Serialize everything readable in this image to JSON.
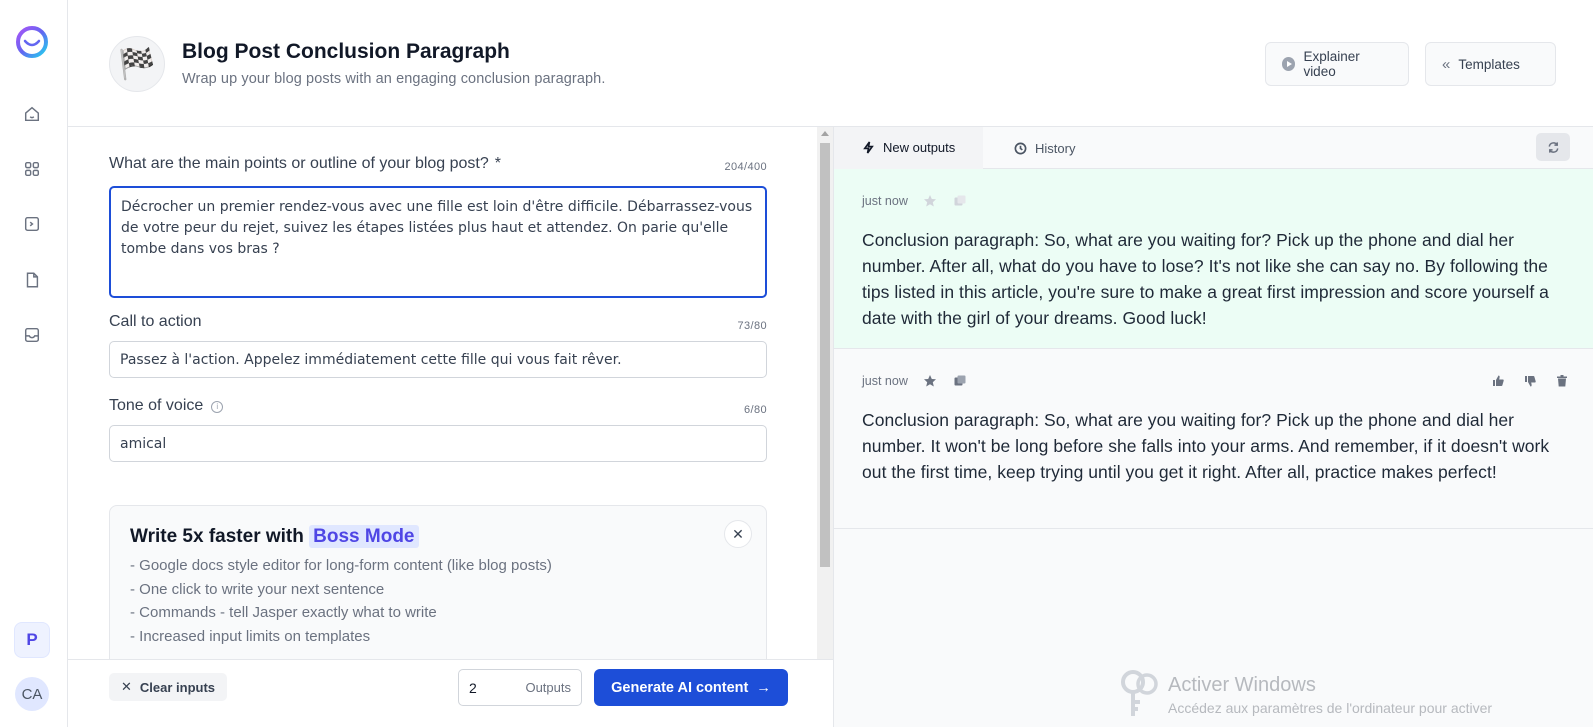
{
  "sidebar": {
    "workspace_initial": "P",
    "user_initials": "CA",
    "items": [
      {
        "icon": "home-icon"
      },
      {
        "icon": "templates-grid-icon"
      },
      {
        "icon": "terminal-icon"
      },
      {
        "icon": "document-icon"
      },
      {
        "icon": "inbox-icon"
      }
    ]
  },
  "header": {
    "template_emoji": "🏁",
    "title": "Blog Post Conclusion Paragraph",
    "subtitle": "Wrap up your blog posts with an engaging conclusion paragraph.",
    "explainer_label": "Explainer video",
    "templates_label": "Templates"
  },
  "form": {
    "outline": {
      "label": "What are the main points or outline of your blog post?",
      "required_marker": "*",
      "counter": "204/400",
      "value": "Décrocher un premier rendez-vous avec une fille est loin d'être difficile. Débarrassez-vous de votre peur du rejet, suivez les étapes listées plus haut et attendez. On parie qu'elle tombe dans vos bras ?"
    },
    "cta": {
      "label": "Call to action",
      "counter": "73/80",
      "value": "Passez à l'action. Appelez immédiatement cette fille qui vous fait rêver."
    },
    "tone": {
      "label": "Tone of voice",
      "counter": "6/80",
      "value": "amical"
    }
  },
  "boss": {
    "title_prefix": "Write 5x faster with",
    "title_highlight": "Boss Mode",
    "items": [
      "- Google docs style editor for long-form content (like blog posts)",
      "- One click to write your next sentence",
      "- Commands - tell Jasper exactly what to write",
      "- Increased input limits on templates"
    ]
  },
  "bottom": {
    "clear_label": "Clear inputs",
    "outputs_count": "2",
    "outputs_label": "Outputs",
    "generate_label": "Generate AI content"
  },
  "outputs": {
    "tab_new": "New outputs",
    "tab_history": "History",
    "items": [
      {
        "time": "just now",
        "text": "Conclusion paragraph: So, what are you waiting for? Pick up the phone and dial her number. After all, what do you have to lose? It's not like she can say no. By following the tips listed in this article, you're sure to make a great first impression and score yourself a date with the girl of your dreams. Good luck!"
      },
      {
        "time": "just now",
        "text": "Conclusion paragraph: So, what are you waiting for? Pick up the phone and dial her number. It won't be long before she falls into your arms. And remember, if it doesn't work out the first time, keep trying until you get it right. After all, practice makes perfect!"
      }
    ]
  },
  "watermark": {
    "title": "Activer Windows",
    "subtitle": "Accédez aux paramètres de l'ordinateur pour activer"
  },
  "colors": {
    "accent": "#1d4ed8",
    "boss_highlight_bg": "#e0e7ff",
    "boss_highlight_text": "#4f46e5",
    "output_new_bg": "#ecfdf5"
  }
}
